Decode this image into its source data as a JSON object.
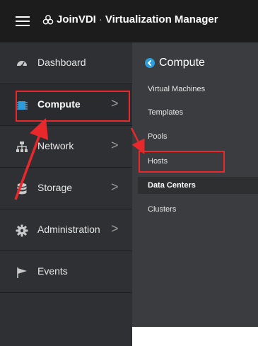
{
  "header": {
    "brand_name": "JoinVDI",
    "separator": "·",
    "app_title": "Virtualization Manager"
  },
  "sidebar": {
    "items": [
      {
        "label": "Dashboard",
        "icon": "dashboard-icon",
        "chevron": ""
      },
      {
        "label": "Compute",
        "icon": "cpu-icon",
        "chevron": ">"
      },
      {
        "label": "Network",
        "icon": "network-icon",
        "chevron": ">"
      },
      {
        "label": "Storage",
        "icon": "database-icon",
        "chevron": ">"
      },
      {
        "label": "Administration",
        "icon": "gear-icon",
        "chevron": ">"
      },
      {
        "label": "Events",
        "icon": "flag-icon",
        "chevron": ""
      }
    ]
  },
  "submenu": {
    "title": "Compute",
    "items": [
      {
        "label": "Virtual Machines"
      },
      {
        "label": "Templates"
      },
      {
        "label": "Pools"
      },
      {
        "label": "Hosts"
      },
      {
        "label": "Data Centers"
      },
      {
        "label": "Clusters"
      }
    ]
  },
  "colors": {
    "header_bg": "#1c1c1c",
    "sidebar_bg": "#2f3033",
    "submenu_bg": "#3b3c3f",
    "accent": "#2d9cdb",
    "annotation": "#e8282b"
  }
}
